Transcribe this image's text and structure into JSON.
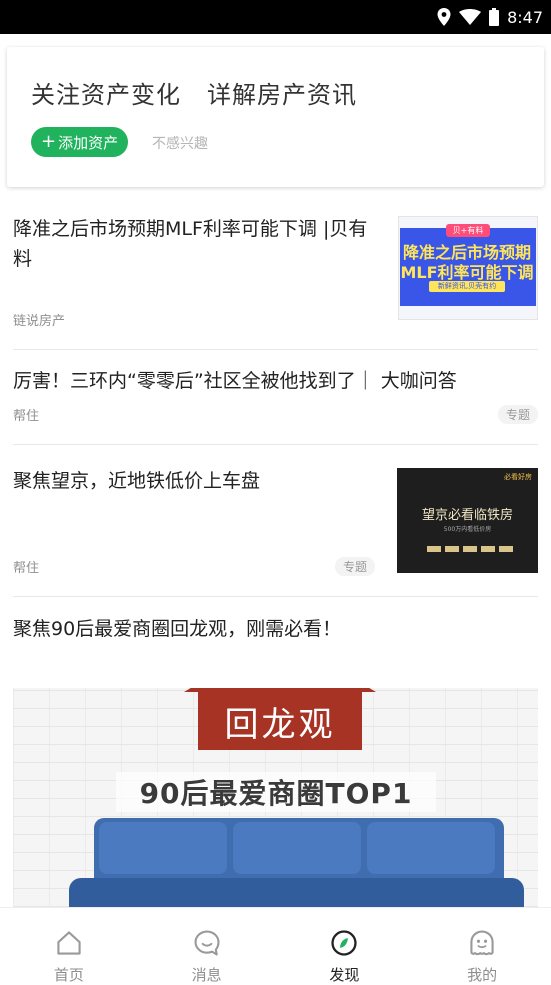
{
  "status_bar": {
    "time": "8:47"
  },
  "interest_card": {
    "headline_left": "关注资产变化",
    "headline_right": "详解房产资讯",
    "add_button": "添加资产",
    "add_button_plus": "+",
    "not_interested": "不感兴趣",
    "accent_color": "#20b25c"
  },
  "feed": [
    {
      "title": "降准之后市场预期MLF利率可能下调 |贝有料",
      "source": "链说房产",
      "thumbnail": {
        "badge": "贝+有料",
        "line1": "降准之后市场预期",
        "line2": "MLF利率可能下调",
        "footer": "新鲜资讯,贝壳有约"
      }
    },
    {
      "title": "厉害！三环内“零零后”社区全被他找到了｜ 大咖问答",
      "source": "帮住",
      "tag": "专题"
    },
    {
      "title": "聚焦望京，近地铁低价上车盘",
      "source": "帮住",
      "tag": "专题",
      "thumbnail": {
        "brand": "必看好房",
        "line1": "望京必看临铁房",
        "line2": "500万内看低价房"
      }
    },
    {
      "title": "聚焦90后最爱商圈回龙观，刚需必看！",
      "banner": {
        "sign": "回龙观",
        "headline": "90后最爱商圈TOP1"
      }
    }
  ],
  "tab_bar": [
    {
      "label": "首页",
      "icon": "home-icon",
      "active": false
    },
    {
      "label": "消息",
      "icon": "message-icon",
      "active": false
    },
    {
      "label": "发现",
      "icon": "compass-icon",
      "active": true
    },
    {
      "label": "我的",
      "icon": "profile-icon",
      "active": false
    }
  ]
}
